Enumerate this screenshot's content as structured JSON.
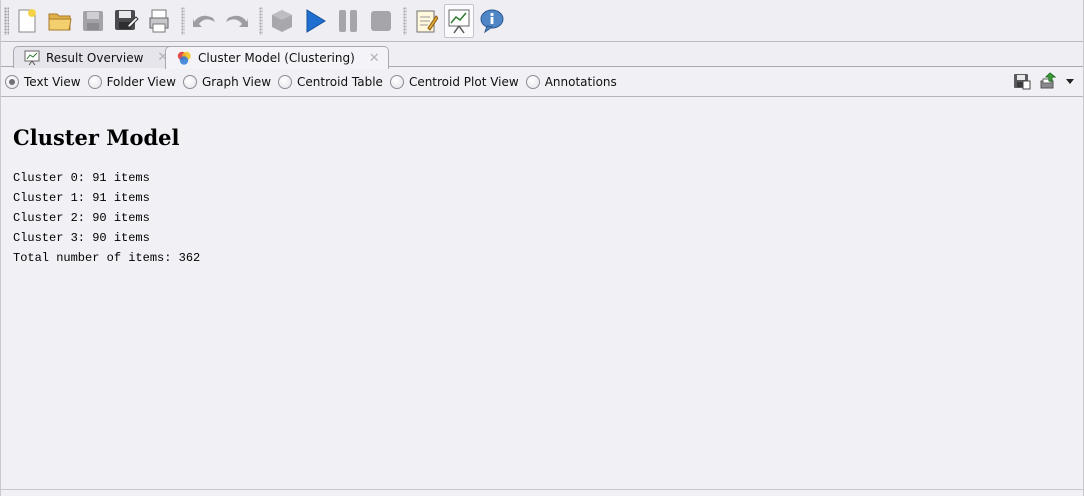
{
  "toolbar": {
    "buttons": [
      {
        "name": "new-process",
        "icon": "new-document-icon",
        "state": "enabled"
      },
      {
        "name": "open-process",
        "icon": "open-folder-icon",
        "state": "enabled"
      },
      {
        "name": "save",
        "icon": "save-disk-icon",
        "state": "disabled"
      },
      {
        "name": "save-as",
        "icon": "save-as-icon",
        "state": "enabled"
      },
      {
        "name": "print",
        "icon": "print-icon",
        "state": "enabled"
      },
      {
        "name": "undo",
        "icon": "undo-icon",
        "state": "disabled"
      },
      {
        "name": "redo",
        "icon": "redo-icon",
        "state": "disabled"
      },
      {
        "name": "validate",
        "icon": "validate-icon",
        "state": "disabled"
      },
      {
        "name": "run",
        "icon": "play-icon",
        "state": "enabled"
      },
      {
        "name": "pause",
        "icon": "pause-icon",
        "state": "disabled"
      },
      {
        "name": "stop",
        "icon": "stop-icon",
        "state": "disabled"
      },
      {
        "name": "design-perspective",
        "icon": "design-notepad-icon",
        "state": "enabled"
      },
      {
        "name": "result-perspective",
        "icon": "result-chart-icon",
        "state": "active"
      },
      {
        "name": "welcome-perspective",
        "icon": "info-icon",
        "state": "enabled"
      }
    ]
  },
  "tabs": [
    {
      "label": "Result Overview",
      "icon": "result-overview-icon",
      "active": false
    },
    {
      "label": "Cluster Model (Clustering)",
      "icon": "cluster-model-icon",
      "active": true
    }
  ],
  "views": {
    "options": [
      "Text View",
      "Folder View",
      "Graph View",
      "Centroid Table",
      "Centroid Plot View",
      "Annotations"
    ],
    "selected": "Text View"
  },
  "content": {
    "title": "Cluster Model",
    "lines": [
      "Cluster 0: 91 items",
      "Cluster 1: 91 items",
      "Cluster 2: 90 items",
      "Cluster 3: 90 items",
      "Total number of items: 362"
    ]
  },
  "colors": {
    "background": "#f1f0f5",
    "play_blue": "#1f6fd1",
    "border": "#a9a9b2"
  }
}
